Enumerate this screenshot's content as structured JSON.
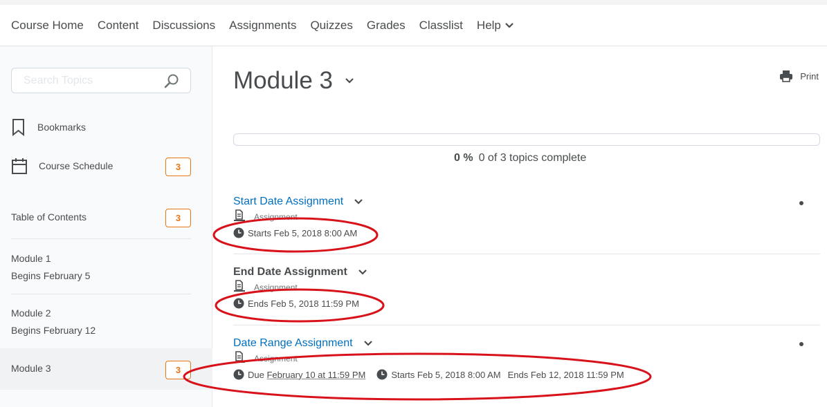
{
  "nav": {
    "items": [
      "Course Home",
      "Content",
      "Discussions",
      "Assignments",
      "Quizzes",
      "Grades",
      "Classlist",
      "Help"
    ]
  },
  "sidebar": {
    "search_placeholder": "Search Topics",
    "bookmarks_label": "Bookmarks",
    "schedule_label": "Course Schedule",
    "schedule_count": "3",
    "toc_label": "Table of Contents",
    "toc_count": "3",
    "modules": [
      {
        "name": "Module 1",
        "sub": "Begins February 5"
      },
      {
        "name": "Module 2",
        "sub": "Begins February 12"
      },
      {
        "name": "Module 3",
        "sub": "",
        "count": "3"
      }
    ]
  },
  "main": {
    "title": "Module 3",
    "print_label": "Print",
    "progress_percent": "0 %",
    "progress_fraction": 0,
    "progress_text": "0 of 3 topics complete",
    "topics": [
      {
        "title": "Start Date Assignment",
        "type": "Assignment",
        "dates": [
          "Starts Feb 5, 2018 8:00 AM"
        ]
      },
      {
        "title": "End Date Assignment",
        "type": "Assignment",
        "dates": [
          "Ends Feb 5, 2018 11:59 PM"
        ]
      },
      {
        "title": "Date Range Assignment",
        "type": "Assignment",
        "due_prefix": "Due",
        "due_link": "February 10 at 11:59 PM",
        "starts": "Starts Feb 5, 2018 8:00 AM",
        "ends": "Ends Feb 12, 2018 11:59 PM"
      }
    ]
  },
  "colors": {
    "accent": "#e87511",
    "link": "#006fbf",
    "annotation": "#d8121b"
  }
}
